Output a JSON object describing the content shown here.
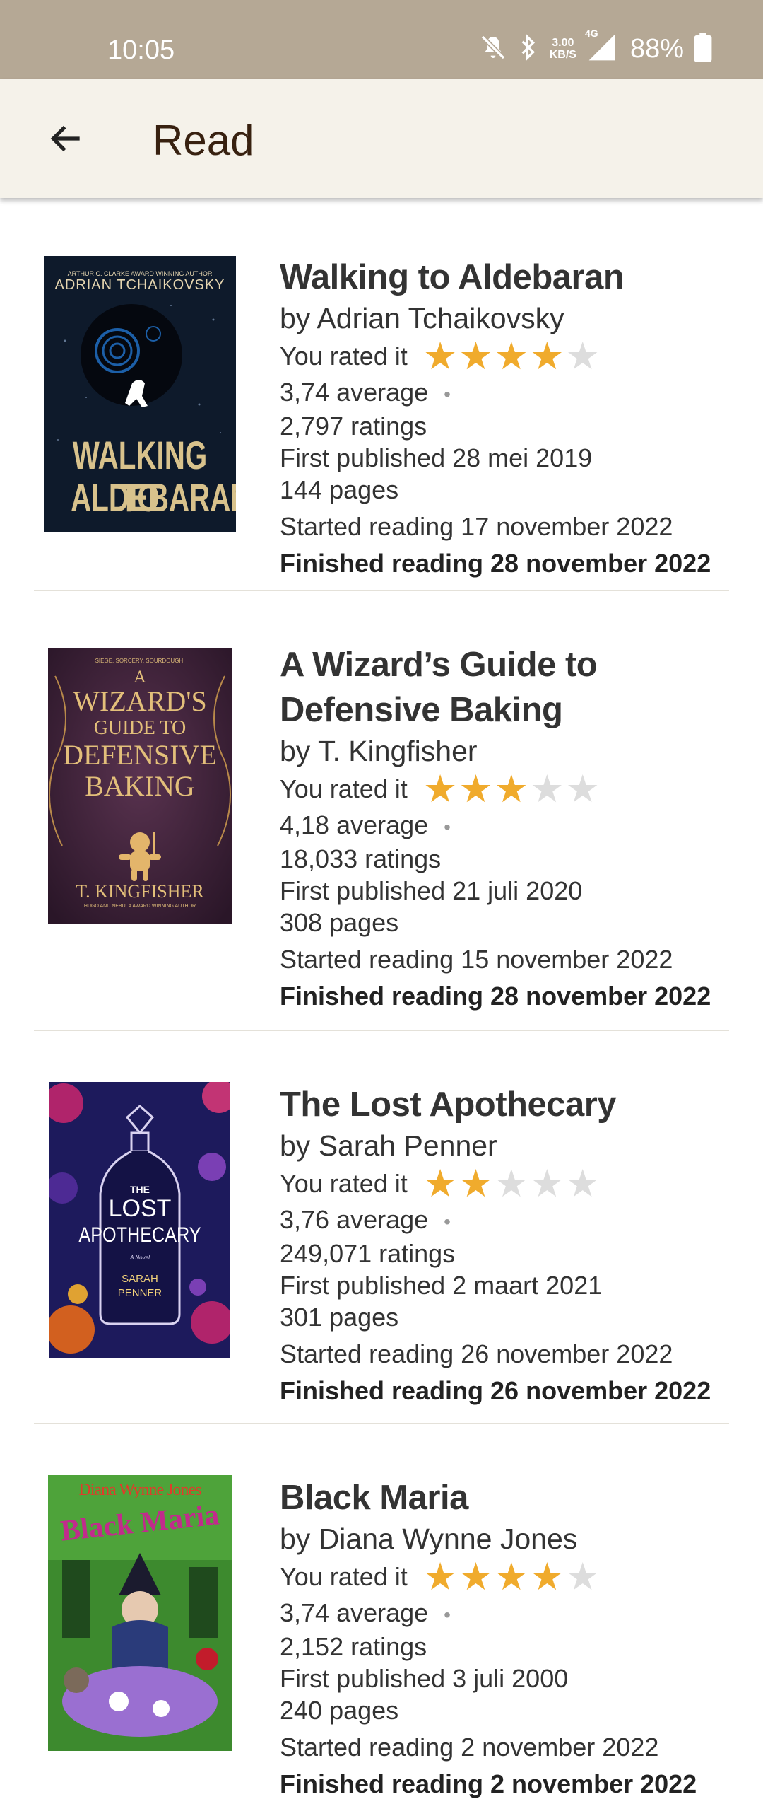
{
  "status_bar": {
    "time": "10:05",
    "net_speed_value": "3.00",
    "net_speed_unit": "KB/S",
    "network": "4G",
    "battery": "88%"
  },
  "app_bar": {
    "title": "Read",
    "back_icon": "arrow-left-icon"
  },
  "colors": {
    "status_bar": "#b5a895",
    "app_bar": "#f5f2ea",
    "star_on": "#f0ab2d",
    "star_off": "#dddddd"
  },
  "books": [
    {
      "title": "Walking to Aldebaran",
      "author": "by Adrian Tchaikovsky",
      "rated_label": "You rated it",
      "rating": 4,
      "average": "3,74 average",
      "ratings_count": "2,797 ratings",
      "first_published": "First published 28 mei 2019",
      "pages": "144 pages",
      "started": "Started reading 17 november 2022",
      "finished": "Finished reading 28 november 2022",
      "cover": {
        "top_line": "ARTHUR C. CLARKE AWARD WINNING AUTHOR",
        "author": "ADRIAN TCHAIKOVSKY",
        "title_line1": "WALKING TO",
        "title_line2": "ALDEBARAN"
      }
    },
    {
      "title": "A Wizard’s Guide to Defensive Baking",
      "author": "by T. Kingfisher",
      "rated_label": "You rated it",
      "rating": 3,
      "average": "4,18 average",
      "ratings_count": "18,033 ratings",
      "first_published": "First published 21 juli 2020",
      "pages": "308 pages",
      "started": "Started reading 15 november 2022",
      "finished": "Finished reading 28 november 2022",
      "cover": {
        "top_line": "SIEGE. SORCERY. SOURDOUGH.",
        "line1": "A",
        "line2": "WIZARD'S",
        "line3": "GUIDE TO",
        "line4": "DEFENSIVE",
        "line5": "BAKING",
        "author": "T. KINGFISHER",
        "bottom_line": "HUGO AND NEBULA AWARD WINNING AUTHOR"
      }
    },
    {
      "title": "The Lost Apothecary",
      "author": "by Sarah Penner",
      "rated_label": "You rated it",
      "rating": 2,
      "average": "3,76 average",
      "ratings_count": "249,071 ratings",
      "first_published": "First published 2 maart 2021",
      "pages": "301 pages",
      "started": "Started reading 26 november 2022",
      "finished": "Finished reading 26 november 2022",
      "cover": {
        "the": "THE",
        "title_line1": "LOST",
        "title_line2": "APOTHECARY",
        "subtitle": "A Novel",
        "author_line1": "SARAH",
        "author_line2": "PENNER"
      }
    },
    {
      "title": "Black Maria",
      "author": "by Diana Wynne Jones",
      "rated_label": "You rated it",
      "rating": 4,
      "average": "3,74 average",
      "ratings_count": "2,152 ratings",
      "first_published": "First published 3 juli 2000",
      "pages": "240 pages",
      "started": "Started reading 2 november 2022",
      "finished": "Finished reading 2 november 2022",
      "cover": {
        "author": "Diana Wynne Jones",
        "title": "Black Maria"
      }
    }
  ]
}
